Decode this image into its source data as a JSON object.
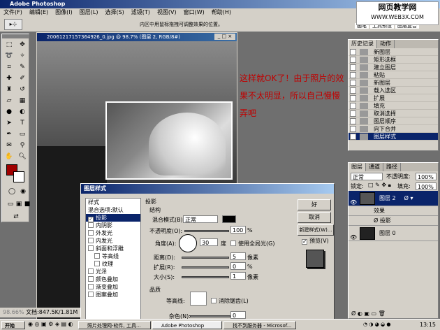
{
  "app": {
    "title": "Adobe Photoshop"
  },
  "menu": [
    "文件(F)",
    "编辑(E)",
    "图像(I)",
    "图层(L)",
    "选择(S)",
    "滤镜(T)",
    "视图(V)",
    "窗口(W)",
    "帮助(H)"
  ],
  "optbar": {
    "hint": "内区中用鼠标拖拽可调整效果的位置。"
  },
  "watermark": {
    "line1": "网页教学网",
    "line2": "WWW.WEB3X.COM"
  },
  "palette_tabs": [
    "画笔",
    "工具预设",
    "图层复合"
  ],
  "document": {
    "title": "20061217157364926_0.jpg @ 98.7% (图层 2, RGB/8#)"
  },
  "annotation": "这样就OK了！由于照片的效果不太明显，所以自己慢慢弄吧",
  "history": {
    "tabs": [
      "历史记录",
      "动作"
    ],
    "items": [
      "新图层",
      "矩形选框",
      "建立图层",
      "粘贴",
      "新图层",
      "载入选区",
      "扩展",
      "填充",
      "取消选择",
      "图层顺序",
      "向下合并",
      "图层样式"
    ]
  },
  "layers": {
    "tabs": [
      "图层",
      "通道",
      "路径"
    ],
    "mode": "正常",
    "opacity_label": "不透明度:",
    "opacity": "100%",
    "lock_label": "锁定:",
    "fill_label": "填充:",
    "fill": "100%",
    "rows": [
      {
        "name": "图层 2"
      },
      {
        "name": "效果"
      },
      {
        "name": "投影"
      },
      {
        "name": "图层 0"
      }
    ]
  },
  "dialog": {
    "title": "图层样式",
    "styles": [
      "样式",
      "混合选项:默认",
      "投影",
      "内阴影",
      "外发光",
      "内发光",
      "斜面和浮雕",
      "等高线",
      "纹理",
      "光泽",
      "颜色叠加",
      "渐变叠加",
      "图案叠加"
    ],
    "section": "投影",
    "structure": "结构",
    "blend_label": "混合模式(B):",
    "blend": "正常",
    "opacity_label": "不透明度(O):",
    "opacity": "100",
    "pct": "%",
    "angle_label": "角度(A):",
    "angle": "30",
    "deg": "度",
    "global_light": "使用全局光(G)",
    "distance_label": "距离(D):",
    "distance": "5",
    "size_label": "扩展(R):",
    "spread": "0",
    "size2_label": "大小(S):",
    "size": "1",
    "px": "像素",
    "quality": "品质",
    "contour_label": "等高线:",
    "antialias": "消除锯齿(L)",
    "noise_label": "杂色(N):",
    "noise": "0",
    "ok": "好",
    "cancel": "取消",
    "new_style": "新建样式(W)...",
    "preview": "预览(V)"
  },
  "status": {
    "zoom": "98.66%",
    "doc": "文档:847.5K/1.81M"
  },
  "taskbar": {
    "start": "开始",
    "tasks": [
      "照片处理网-软件, 工具...",
      "Adobe Photoshop",
      "找不到服务器 - Microsof..."
    ],
    "time": "13:15"
  }
}
